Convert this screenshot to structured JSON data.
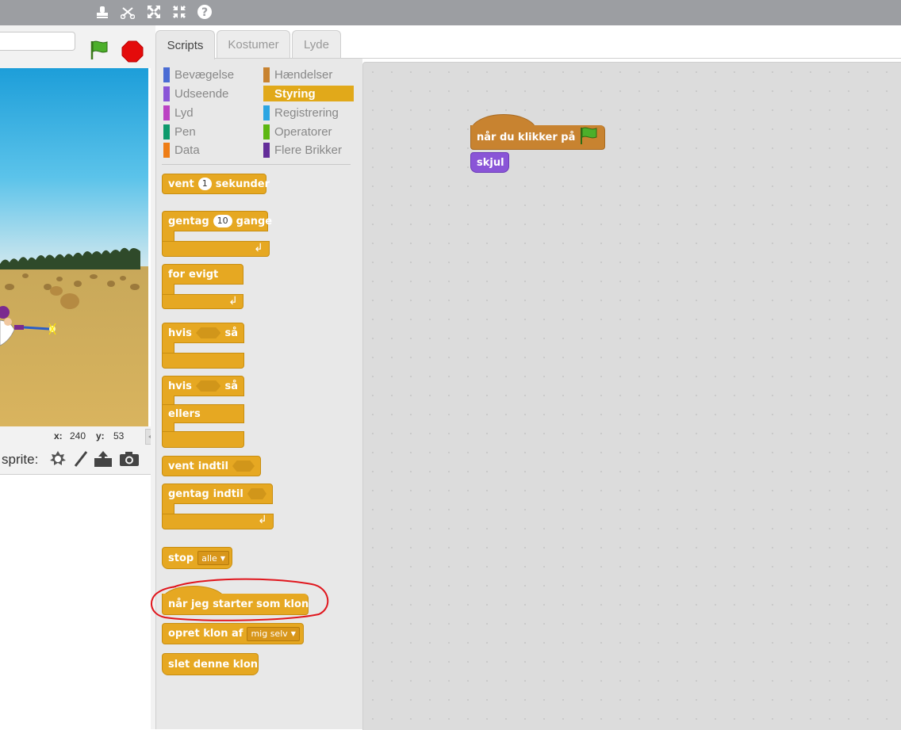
{
  "toolbar": {
    "icons": [
      "stamp-icon",
      "cut-icon",
      "grow-icon",
      "shrink-icon",
      "help-icon"
    ]
  },
  "stage": {
    "coords": {
      "x_label": "x:",
      "x_value": "240",
      "y_label": "y:",
      "y_value": "53"
    },
    "new_sprite_label": "sprite:"
  },
  "tabs": [
    {
      "label": "Scripts",
      "active": true
    },
    {
      "label": "Kostumer",
      "active": false
    },
    {
      "label": "Lyde",
      "active": false
    }
  ],
  "categories": [
    {
      "label": "Bevægelse",
      "color": "#4a6cd4"
    },
    {
      "label": "Udseende",
      "color": "#8a55d7"
    },
    {
      "label": "Lyd",
      "color": "#bb42c3"
    },
    {
      "label": "Pen",
      "color": "#0e9a6c"
    },
    {
      "label": "Data",
      "color": "#ee7d16"
    },
    {
      "label": "Hændelser",
      "color": "#c88330"
    },
    {
      "label": "Styring",
      "color": "#e1a91a"
    },
    {
      "label": "Registrering",
      "color": "#2ca5e2"
    },
    {
      "label": "Operatorer",
      "color": "#5cb712"
    },
    {
      "label": "Flere Brikker",
      "color": "#632d99"
    }
  ],
  "blocks": {
    "wait": {
      "a": "vent",
      "value": "1",
      "b": "sekunder"
    },
    "repeat": {
      "a": "gentag",
      "value": "10",
      "b": "gange"
    },
    "forever": {
      "a": "for",
      "b": "evigt"
    },
    "if_then": {
      "a": "hvis",
      "b": "så"
    },
    "if_else": {
      "a": "hvis",
      "b": "så",
      "c": "ellers"
    },
    "wait_until": {
      "a": "vent",
      "b": "indtil"
    },
    "repeat_until": {
      "a": "gentag",
      "b": "indtil"
    },
    "stop": {
      "a": "stop",
      "option": "alle"
    },
    "clone_hat": "når jeg starter som klon",
    "create_clone": {
      "a": "opret klon af",
      "option": "mig selv"
    },
    "delete_clone": "slet denne klon"
  },
  "script": {
    "hat": "når du klikker på",
    "hide": "skjul"
  },
  "colors": {
    "control": "#e6a822",
    "events": "#c88330",
    "looks": "#8a55d7",
    "annotation": "#e0161d"
  }
}
